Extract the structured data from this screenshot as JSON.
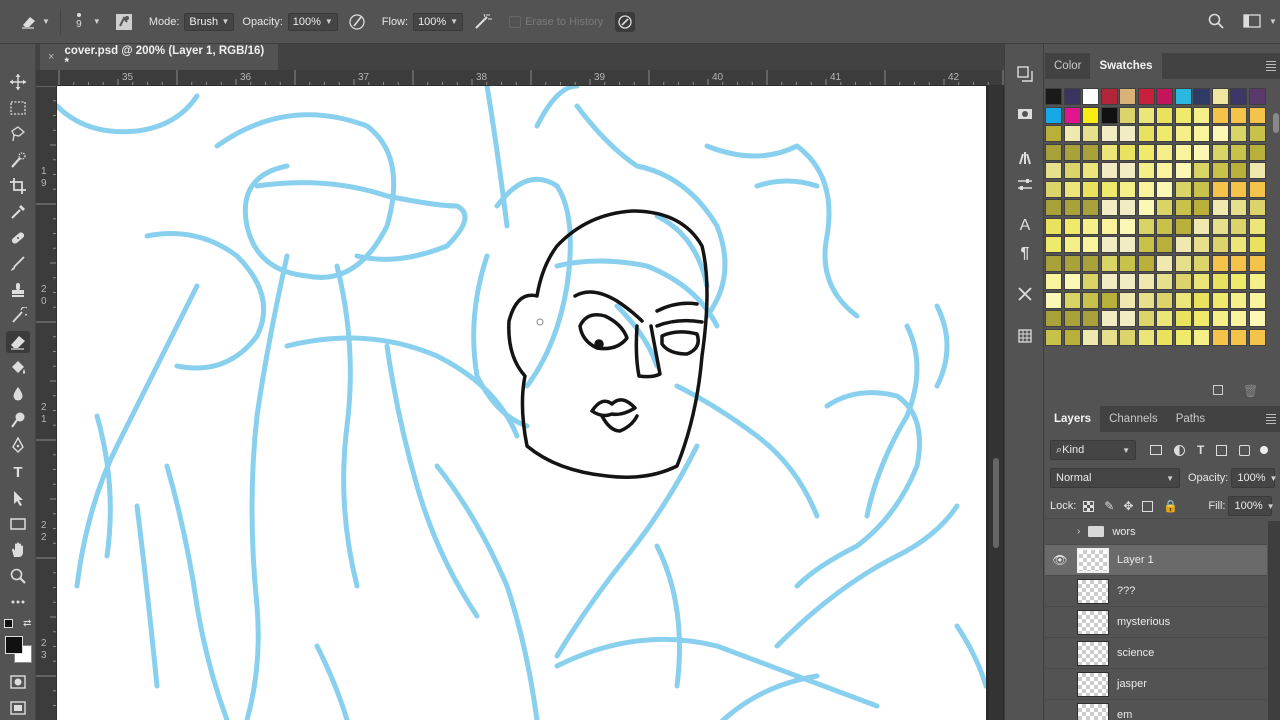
{
  "options_bar": {
    "brush_size": "9",
    "mode_label": "Mode:",
    "mode_value": "Brush",
    "opacity_label": "Opacity:",
    "opacity_value": "100%",
    "flow_label": "Flow:",
    "flow_value": "100%",
    "erase_to_history": "Erase to History"
  },
  "document": {
    "tab_title": "cover.psd @ 200% (Layer 1, RGB/16) *",
    "close": "×"
  },
  "rulers": {
    "top": [
      "35",
      "36",
      "37",
      "38",
      "39",
      "40",
      "41",
      "42"
    ],
    "left": [
      "1",
      "9",
      "2",
      "0",
      "2",
      "1",
      "2",
      "2",
      "2",
      "3"
    ]
  },
  "color_panel": {
    "tabs": [
      "Color",
      "Swatches"
    ],
    "active_tab": "Swatches",
    "top_row": [
      "#1a1a1a",
      "#3a3560",
      "#ffffff",
      "#b32538",
      "#d9b27a",
      "#c8203c",
      "#c4155a",
      "#29b8e0",
      "#2f3a66",
      "#f0e6a0",
      "#3d3668",
      "#5a3a6a"
    ],
    "second_row_left": [
      "#16a9e8",
      "#e0148c",
      "#f7ec14",
      "#111111"
    ]
  },
  "layers_panel": {
    "tabs": [
      "Layers",
      "Channels",
      "Paths"
    ],
    "active_tab": "Layers",
    "filter_kind": "Kind",
    "blend_mode": "Normal",
    "opacity_label": "Opacity:",
    "opacity_value": "100%",
    "lock_label": "Lock:",
    "fill_label": "Fill:",
    "fill_value": "100%",
    "group_name": "wors",
    "layers": [
      "Layer 1",
      "???",
      "mysterious",
      "science",
      "jasper",
      "em"
    ],
    "selected_layer": "Layer 1"
  }
}
